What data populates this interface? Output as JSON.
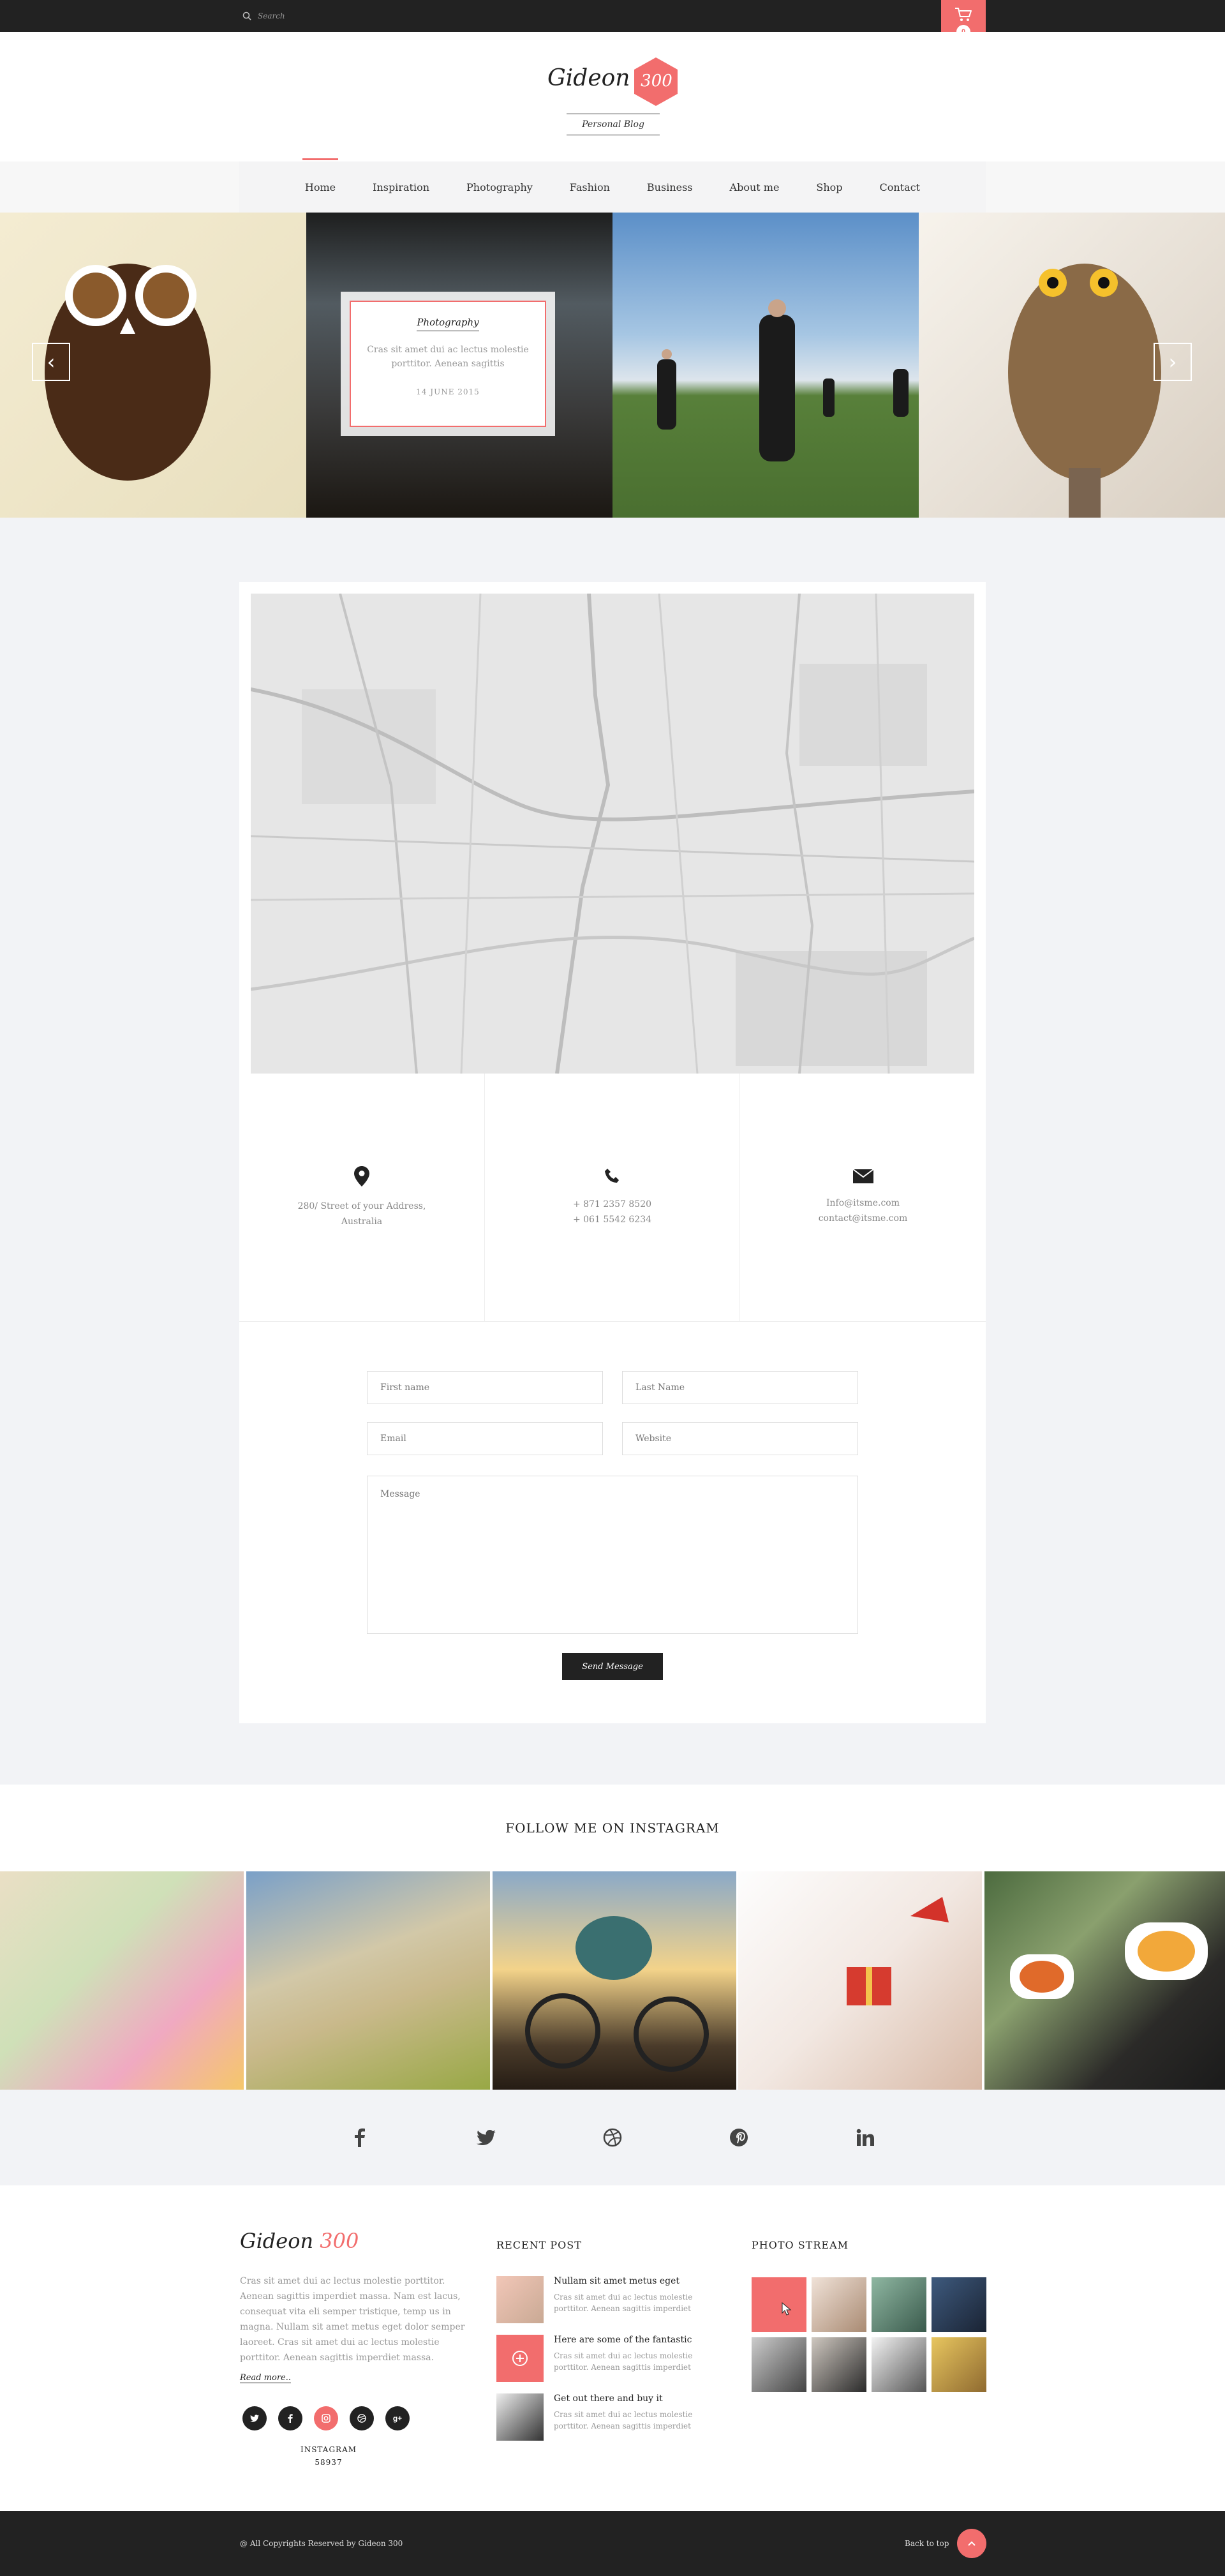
{
  "topbar": {
    "search_placeholder": "Search",
    "cart_count": "0"
  },
  "brand": {
    "name": "Gideon",
    "number": "300",
    "tagline": "Personal Blog"
  },
  "nav": {
    "items": [
      "Home",
      "Inspiration",
      "Photography",
      "Fashion",
      "Business",
      "About me",
      "Shop",
      "Contact"
    ],
    "active": "Home"
  },
  "slider": {
    "caption": {
      "category": "Photography",
      "text": "Cras sit amet dui ac lectus molestie porttitor. Aenean sagittis",
      "date": "14 JUNE 2015"
    }
  },
  "contact": {
    "address": {
      "line1": "280/ Street of your Address,",
      "line2": "Australia"
    },
    "phone": {
      "line1": "+ 871 2357 8520",
      "line2": "+ 061 5542 6234"
    },
    "email": {
      "line1": "Info@itsme.com",
      "line2": "contact@itsme.com"
    }
  },
  "form": {
    "first_name_placeholder": "First name",
    "last_name_placeholder": "Last Name",
    "email_placeholder": "Email",
    "website_placeholder": "Website",
    "message_placeholder": "Message",
    "send_label": "Send Message"
  },
  "instagram": {
    "title": "FOLLOW ME ON INSTAGRAM"
  },
  "social_icons": [
    "facebook-icon",
    "twitter-icon",
    "dribbble-icon",
    "pinterest-icon",
    "linkedin-icon"
  ],
  "footer": {
    "about": {
      "text": "Cras sit amet dui ac lectus molestie porttitor. Aenean sagittis imperdiet massa. Nam est lacus, consequat vita eli semper tristique, temp us in magna. Nullam sit amet metus eget dolor semper laoreet. Cras sit amet dui ac lectus molestie porttitor. Aenean sagittis imperdiet massa.",
      "read_more": "Read more..",
      "instagram_label": "INSTAGRAM",
      "instagram_count": "58937"
    },
    "recent_post": {
      "heading": "RECENT POST",
      "posts": [
        {
          "title": "Nullam sit amet metus eget",
          "text": "Cras sit amet dui ac lectus molestie porttitor. Aenean sagittis imperdiet"
        },
        {
          "title": "Here are some of the fantastic",
          "text": "Cras sit amet dui ac lectus molestie porttitor. Aenean sagittis imperdiet"
        },
        {
          "title": "Get out there and buy it",
          "text": "Cras sit amet dui ac lectus molestie porttitor. Aenean sagittis imperdiet"
        }
      ]
    },
    "photo_stream": {
      "heading": "PHOTO STREAM"
    }
  },
  "bottombar": {
    "copyright": "@ All Copyrights Reserved by Gideon 300",
    "back_to_top": "Back to top"
  },
  "colors": {
    "accent": "#f26d6d",
    "dark": "#222222",
    "background": "#f2f3f6"
  }
}
